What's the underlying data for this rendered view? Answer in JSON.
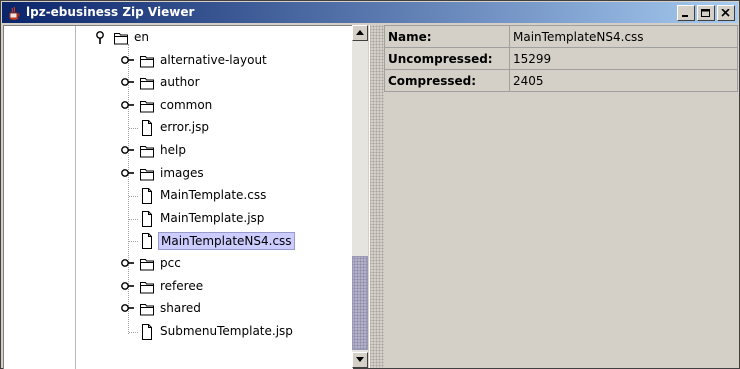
{
  "window": {
    "title": "lpz-ebusiness Zip Viewer",
    "title_gradient": [
      "#0a246a",
      "#a6caf0"
    ]
  },
  "tree": {
    "root_label": "en",
    "items": [
      {
        "label": "alternative-layout",
        "type": "folder"
      },
      {
        "label": "author",
        "type": "folder"
      },
      {
        "label": "common",
        "type": "folder"
      },
      {
        "label": "error.jsp",
        "type": "file"
      },
      {
        "label": "help",
        "type": "folder"
      },
      {
        "label": "images",
        "type": "folder"
      },
      {
        "label": "MainTemplate.css",
        "type": "file"
      },
      {
        "label": "MainTemplate.jsp",
        "type": "file"
      },
      {
        "label": "MainTemplateNS4.css",
        "type": "file",
        "selected": true
      },
      {
        "label": "pcc",
        "type": "folder"
      },
      {
        "label": "referee",
        "type": "folder"
      },
      {
        "label": "shared",
        "type": "folder"
      },
      {
        "label": "SubmenuTemplate.jsp",
        "type": "file"
      }
    ]
  },
  "properties": {
    "rows": [
      {
        "name": "Name:",
        "value": "MainTemplateNS4.css"
      },
      {
        "name": "Uncompressed:",
        "value": "15299"
      },
      {
        "name": "Compressed:",
        "value": "2405"
      }
    ]
  },
  "colors": {
    "selection_bg": "#ccccff",
    "scroll_thumb": "#b4b0c8",
    "panel_bg": "#d4d0c8"
  }
}
